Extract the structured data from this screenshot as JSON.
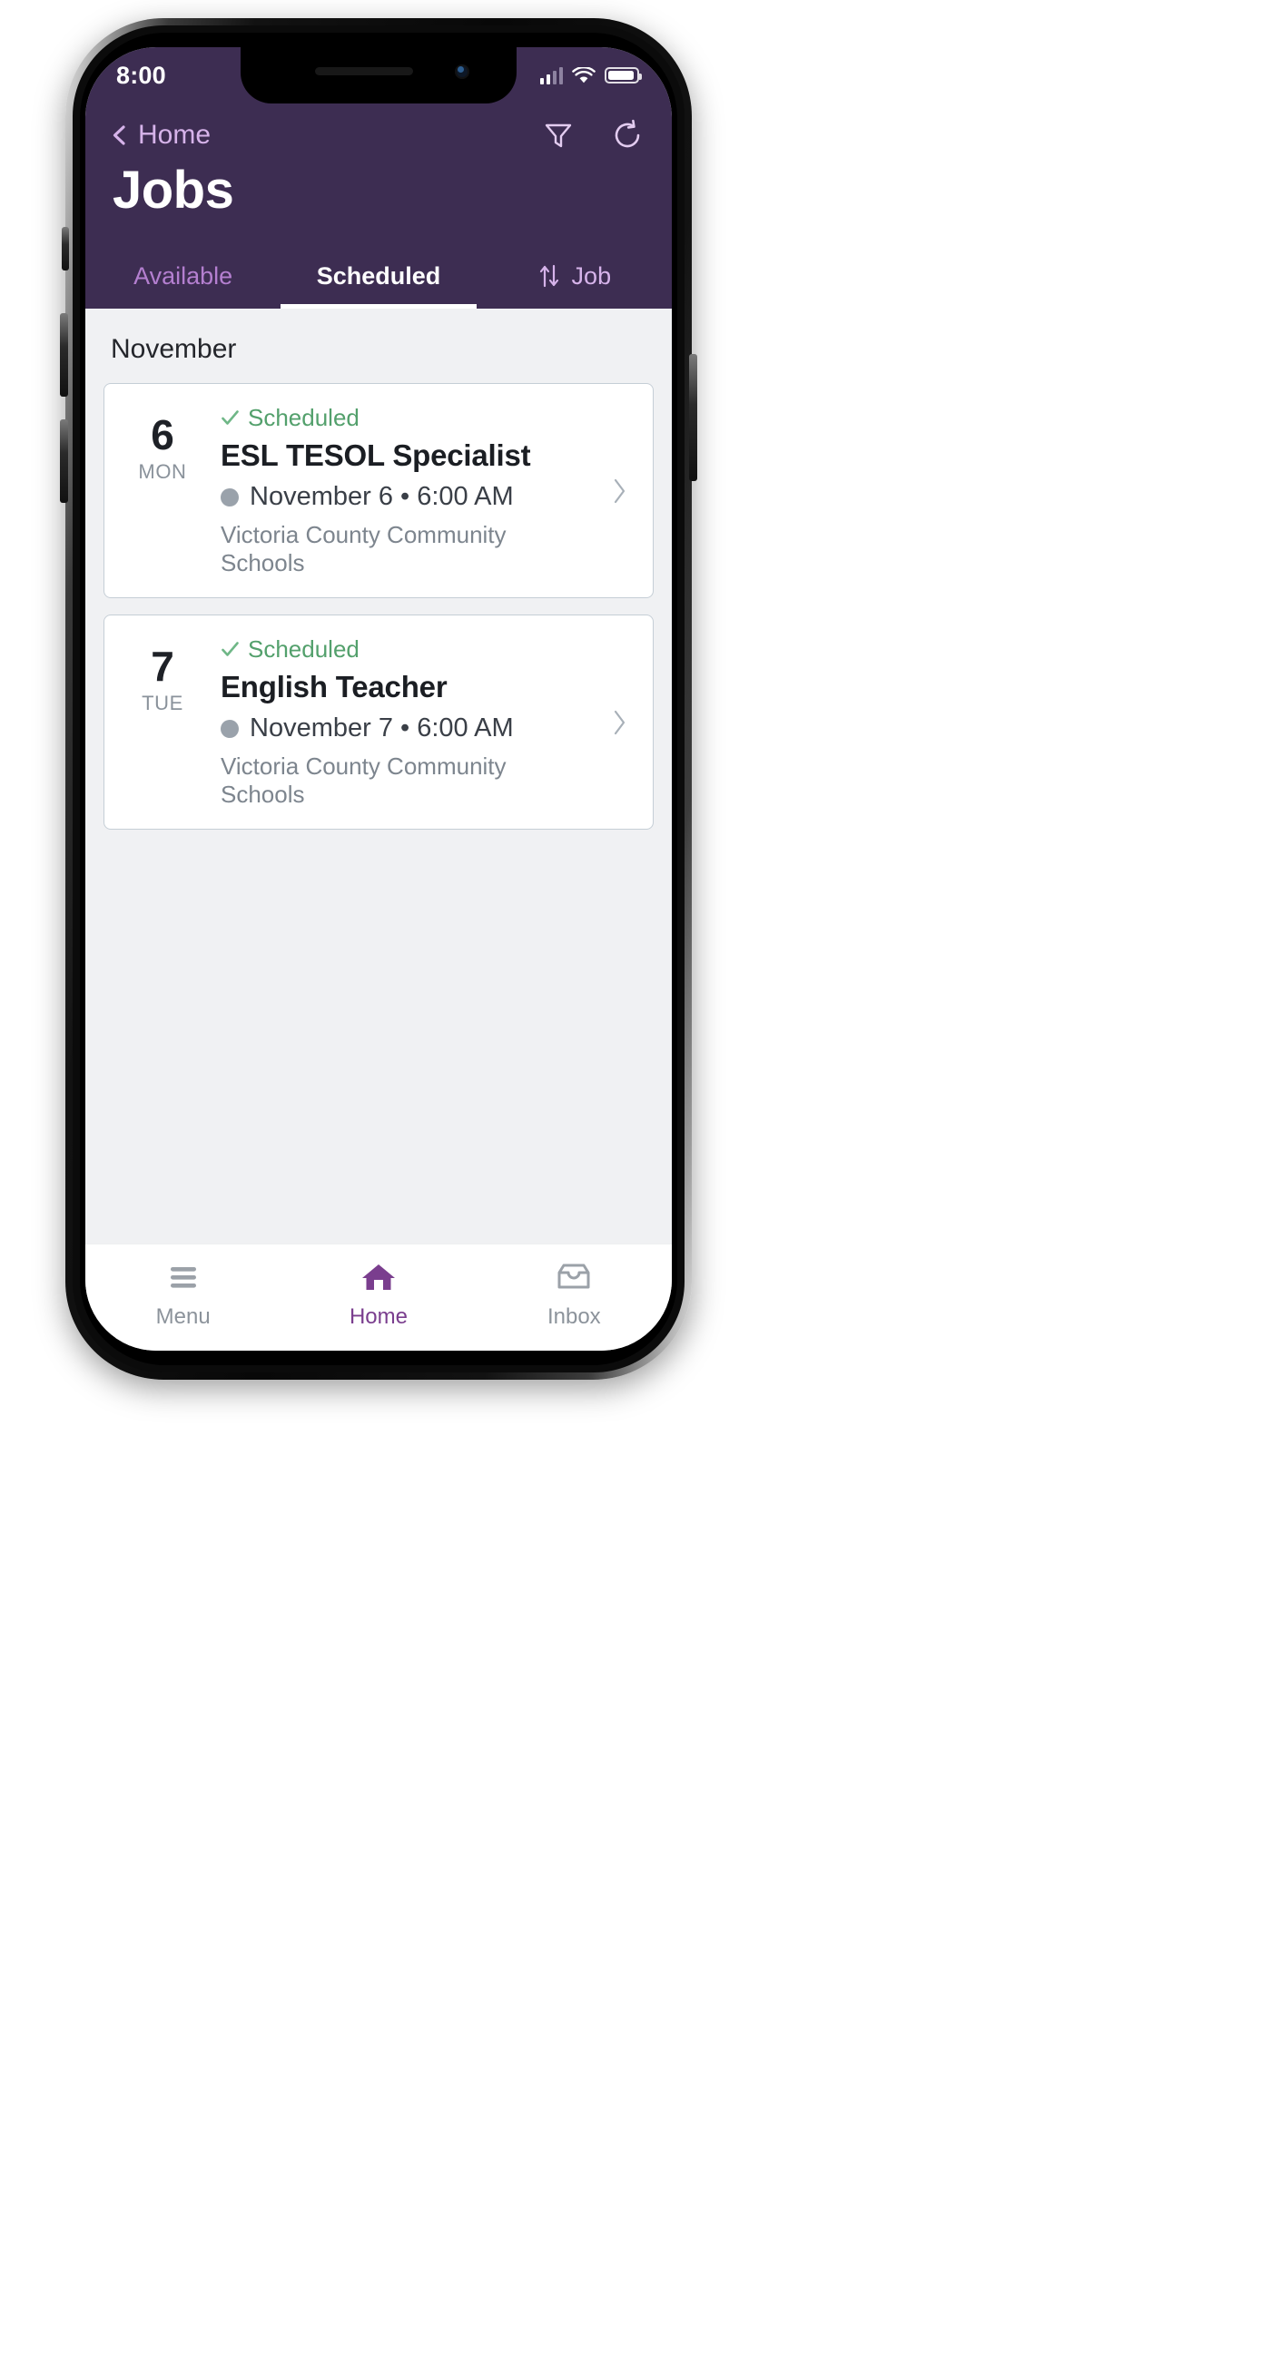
{
  "device": {
    "status_bar": {
      "time": "8:00",
      "signal_icon": "cellular-signal-icon",
      "wifi_icon": "wifi-icon",
      "battery_icon": "battery-icon"
    }
  },
  "header": {
    "back_label": "Home",
    "back_icon": "chevron-left-icon",
    "title": "Jobs",
    "actions": [
      {
        "name": "filter-icon",
        "label": "Filter"
      },
      {
        "name": "refresh-icon",
        "label": "Refresh"
      }
    ],
    "colors": {
      "background": "#3D2D52",
      "accent_light": "#D6B3EA",
      "tab_inactive": "#B47FD0"
    }
  },
  "tabs": [
    {
      "label": "Available",
      "active": false
    },
    {
      "label": "Scheduled",
      "active": true
    }
  ],
  "sort": {
    "label": "Job",
    "icon": "sort-arrows-icon"
  },
  "main": {
    "month_label": "November",
    "jobs": [
      {
        "day_number": "6",
        "day_name": "MON",
        "status": "Scheduled",
        "status_icon": "check-icon",
        "status_color": "#53A06C",
        "title": "ESL TESOL Specialist",
        "when": "November 6 • 6:00 AM",
        "organization": "Victoria County Community Schools",
        "chevron_icon": "chevron-right-icon"
      },
      {
        "day_number": "7",
        "day_name": "TUE",
        "status": "Scheduled",
        "status_icon": "check-icon",
        "status_color": "#53A06C",
        "title": "English Teacher",
        "when": "November 7 • 6:00 AM",
        "organization": "Victoria County Community Schools",
        "chevron_icon": "chevron-right-icon"
      }
    ]
  },
  "bottom_nav": [
    {
      "label": "Menu",
      "icon": "hamburger-menu-icon",
      "active": false
    },
    {
      "label": "Home",
      "icon": "home-icon",
      "active": true
    },
    {
      "label": "Inbox",
      "icon": "inbox-tray-icon",
      "active": false
    }
  ]
}
